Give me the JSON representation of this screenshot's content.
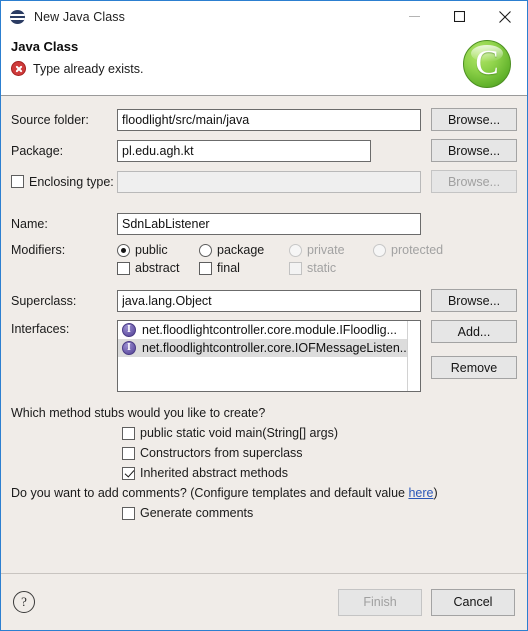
{
  "window": {
    "title": "New Java Class",
    "app_icon": "eclipse-sphere-icon",
    "controls": {
      "minimize": "minimize-icon",
      "maximize": "maximize-icon",
      "close": "close-icon"
    }
  },
  "header": {
    "title": "Java Class",
    "message": "Type already exists.",
    "message_icon": "error-icon",
    "banner_icon": "new-class-c-icon",
    "banner_glyph": "C",
    "error_color": "#cf3b3b",
    "banner_color": "#8ed24a"
  },
  "fields": {
    "source_folder": {
      "label": "Source folder:",
      "value": "floodlight/src/main/java",
      "browse": "Browse...",
      "enabled": true
    },
    "package": {
      "label": "Package:",
      "value": "pl.edu.agh.kt",
      "browse": "Browse...",
      "enabled": true
    },
    "enclosing_type": {
      "label": "Enclosing type:",
      "value": "",
      "browse": "Browse...",
      "checked": false,
      "enabled": false
    },
    "name": {
      "label": "Name:",
      "value": "SdnLabListener",
      "enabled": true
    },
    "superclass": {
      "label": "Superclass:",
      "value": "java.lang.Object",
      "browse": "Browse...",
      "enabled": true
    }
  },
  "modifiers": {
    "label": "Modifiers:",
    "access": [
      {
        "label": "public",
        "selected": true,
        "enabled": true
      },
      {
        "label": "package",
        "selected": false,
        "enabled": true
      },
      {
        "label": "private",
        "selected": false,
        "enabled": false
      },
      {
        "label": "protected",
        "selected": false,
        "enabled": false
      }
    ],
    "flags": [
      {
        "label": "abstract",
        "checked": false,
        "enabled": true
      },
      {
        "label": "final",
        "checked": false,
        "enabled": true
      },
      {
        "label": "static",
        "checked": false,
        "enabled": false
      }
    ]
  },
  "interfaces": {
    "label": "Interfaces:",
    "items": [
      {
        "text": "net.floodlightcontroller.core.module.IFloodlig...",
        "icon": "interface-icon",
        "selected": false
      },
      {
        "text": "net.floodlightcontroller.core.IOFMessageListen...",
        "icon": "interface-icon",
        "selected": true
      }
    ],
    "add_label": "Add...",
    "remove_label": "Remove"
  },
  "stubs": {
    "question": "Which method stubs would you like to create?",
    "options": [
      {
        "label": "public static void main(String[] args)",
        "checked": false
      },
      {
        "label": "Constructors from superclass",
        "checked": false
      },
      {
        "label": "Inherited abstract methods",
        "checked": true
      }
    ]
  },
  "comments": {
    "question_prefix": "Do you want to add comments? (Configure templates and default value ",
    "link": "here",
    "question_suffix": ")",
    "option": {
      "label": "Generate comments",
      "checked": false
    }
  },
  "footer": {
    "help_label": "?",
    "finish_label": "Finish",
    "finish_enabled": false,
    "cancel_label": "Cancel",
    "cancel_enabled": true
  }
}
